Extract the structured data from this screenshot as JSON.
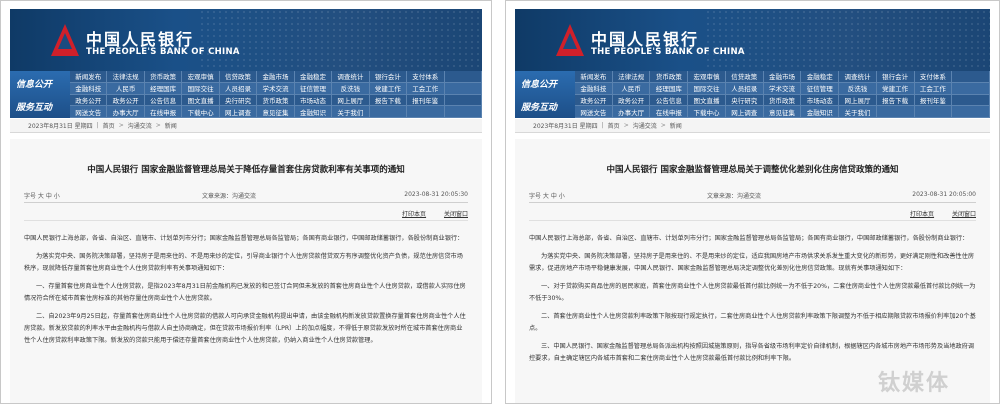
{
  "left": {
    "logo": {
      "cn": "中国人民银行",
      "en": "THE PEOPLE'S BANK OF CHINA"
    },
    "nav": {
      "side_labels": [
        "信息公开",
        "服务互动"
      ],
      "rows": [
        [
          "新闻发布",
          "法律法规",
          "货币政策",
          "宏观审慎",
          "信贷政策",
          "金融市场",
          "金融稳定",
          "调查统计",
          "银行会计",
          "支付体系"
        ],
        [
          "金融科技",
          "人民币",
          "经理国库",
          "国际交往",
          "人员招录",
          "学术交流",
          "征信管理",
          "反洗钱",
          "党建工作",
          "工会工作"
        ],
        [
          "政务公开",
          "政务公开",
          "公告信息",
          "图文直播",
          "央行研究",
          "货币政策",
          "市场动态",
          "网上展厅",
          "报告下载",
          "报刊年鉴"
        ],
        [
          "网送文告",
          "办事大厅",
          "在线申报",
          "下载中心",
          "网上调查",
          "意见征集",
          "金融知识",
          "关于我们"
        ]
      ]
    },
    "breadcrumb": [
      "2023年8月31日 星期四",
      "首页",
      "沟通交流",
      "新闻"
    ],
    "article": {
      "title": "中国人民银行  国家金融监督管理总局关于降低存量首套住房贷款利率有关事项的通知",
      "author": "字号  大  中  小",
      "source": "文章来源：沟通交流",
      "date": "2023-08-31  20:05:30",
      "print": "打印本页",
      "close": "关闭窗口",
      "paragraphs": [
        "中国人民银行上海总部，各省、自治区、直辖市、计划单列市分行；国家金融监督管理总局各监管局；各国有商业银行，中国邮政储蓄银行，各股份制商业银行：",
        "为落实党中央、国务院决策部署，坚持房子是用来住的、不是用来炒的定位，引导商业银行个人住房贷款借贷双方有序调整优化资产负债，规范住房信贷市场秩序，现就降低存量首套住房商业性个人住房贷款利率有关事项通知如下：",
        "一、存量首套住房商业性个人住房贷款，是指2023年8月31日前金融机构已发放的和已签订合同但未发放的首套住房商业性个人住房贷款，或借款人实际住房情况符合所在城市首套住房标准的其他存量住房商业性个人住房贷款。",
        "二、自2023年9月25日起，存量首套住房商业性个人住房贷款的借款人可向承贷金融机构提出申请，由该金融机构新发放贷款置换存量首套住房商业性个人住房贷款。新发放贷款的利率水平由金融机构与借款人自主协商确定，但在贷款市场报价利率（LPR）上的加点幅度，不得低于原贷款发放时所在城市首套住房商业性个人住房贷款利率政策下限。新发放的贷款只能用于偿还存量首套住房商业性个人住房贷款，仍纳入商业性个人住房贷款管理。"
      ]
    }
  },
  "right": {
    "logo": {
      "cn": "中国人民银行",
      "en": "THE PEOPLE'S BANK OF CHINA"
    },
    "nav": {
      "side_labels": [
        "信息公开",
        "服务互动"
      ],
      "rows": [
        [
          "新闻发布",
          "法律法规",
          "货币政策",
          "宏观审慎",
          "信贷政策",
          "金融市场",
          "金融稳定",
          "调查统计",
          "银行会计",
          "支付体系"
        ],
        [
          "金融科技",
          "人民币",
          "经理国库",
          "国际交往",
          "人员招录",
          "学术交流",
          "征信管理",
          "反洗钱",
          "党建工作",
          "工会工作"
        ],
        [
          "政务公开",
          "政务公开",
          "公告信息",
          "图文直播",
          "央行研究",
          "货币政策",
          "市场动态",
          "网上展厅",
          "报告下载",
          "报刊年鉴"
        ],
        [
          "网送文告",
          "办事大厅",
          "在线申报",
          "下载中心",
          "网上调查",
          "意见征集",
          "金融知识",
          "关于我们"
        ]
      ]
    },
    "breadcrumb": [
      "2023年8月31日 星期四",
      "首页",
      "沟通交流",
      "新闻"
    ],
    "article": {
      "title": "中国人民银行  国家金融监督管理总局关于调整优化差别化住房信贷政策的通知",
      "author": "字号  大  中  小",
      "source": "文章来源：沟通交流",
      "date": "2023-08-31  20:05:00",
      "print": "打印本页",
      "close": "关闭窗口",
      "paragraphs": [
        "中国人民银行上海总部，各省、自治区、直辖市、计划单列市分行；国家金融监督管理总局各监管局；各国有商业银行，中国邮政储蓄银行，各股份制商业银行：",
        "为落实党中央、国务院决策部署，坚持房子是用来住的、不是用来炒的定位，适应我国房地产市场供求关系发生重大变化的新形势，更好满足刚性和改善性住房需求，促进房地产市场平稳健康发展，中国人民银行、国家金融监督管理总局决定调整优化差别化住房信贷政策。现就有关事项通知如下：",
        "一、对于贷款购买商品住房的居民家庭，首套住房商业性个人住房贷款最低首付款比例统一为不低于20%，二套住房商业性个人住房贷款最低首付款比例统一为不低于30%。",
        "二、首套住房商业性个人住房贷款利率政策下限按现行规定执行，二套住房商业性个人住房贷款利率政策下限调整为不低于相应期限贷款市场报价利率加20个基点。",
        "三、中国人民银行、国家金融监督管理总局各派出机构按照因城施策原则，指导各省级市场利率定价自律机制，根据辖区内各城市房地产市场形势及当地政府调控要求，自主确定辖区内各城市首套和二套住房商业性个人住房贷款最低首付款比例和利率下限。"
      ]
    },
    "watermark": "钛媒体"
  }
}
